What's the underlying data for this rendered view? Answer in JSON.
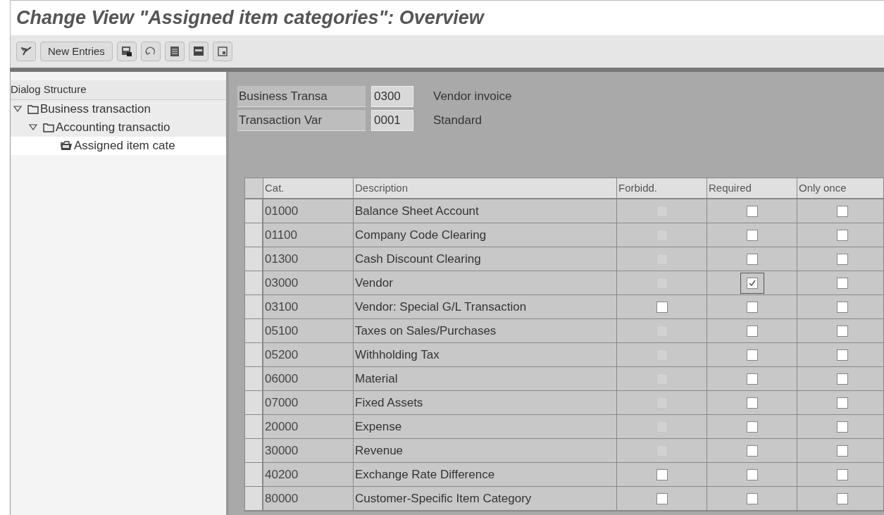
{
  "window": {
    "title": "Change View \"Assigned item categories\": Overview"
  },
  "toolbar": {
    "items": [
      {
        "kind": "icon"
      },
      {
        "kind": "text",
        "label": "New Entries"
      },
      {
        "kind": "icon"
      },
      {
        "kind": "icon"
      },
      {
        "kind": "icon"
      },
      {
        "kind": "icon"
      },
      {
        "kind": "icon"
      }
    ]
  },
  "dialog_structure": {
    "title": "Dialog Structure",
    "items": [
      {
        "label": "Business transaction",
        "expanded": true,
        "selected": false,
        "children": [
          {
            "label": "Accounting transactio",
            "expanded": true,
            "selected": false,
            "children": [
              {
                "label": "Assigned item cate",
                "selected": true
              }
            ]
          }
        ]
      }
    ]
  },
  "header_fields": [
    {
      "label": "Business Transa",
      "value": "0300",
      "description": "Vendor invoice"
    },
    {
      "label": "Transaction Var",
      "value": "0001",
      "description": "Standard"
    }
  ],
  "table": {
    "columns": [
      "Cat.",
      "Description",
      "Forbidd.",
      "Required",
      "Only once"
    ],
    "rows": [
      {
        "cat": "01000",
        "description": "Balance Sheet Account",
        "forbidden": {
          "checked": false,
          "disabled": true
        },
        "required": {
          "checked": false,
          "focused": false
        },
        "only_once": {
          "checked": false
        }
      },
      {
        "cat": "01100",
        "description": "Company Code Clearing",
        "forbidden": {
          "checked": false,
          "disabled": true
        },
        "required": {
          "checked": false,
          "focused": false
        },
        "only_once": {
          "checked": false
        }
      },
      {
        "cat": "01300",
        "description": "Cash Discount Clearing",
        "forbidden": {
          "checked": false,
          "disabled": true
        },
        "required": {
          "checked": false,
          "focused": false
        },
        "only_once": {
          "checked": false
        }
      },
      {
        "cat": "03000",
        "description": "Vendor",
        "forbidden": {
          "checked": false,
          "disabled": true
        },
        "required": {
          "checked": true,
          "focused": true
        },
        "only_once": {
          "checked": false
        }
      },
      {
        "cat": "03100",
        "description": "Vendor: Special G/L Transaction",
        "forbidden": {
          "checked": false,
          "disabled": false
        },
        "required": {
          "checked": false,
          "focused": false
        },
        "only_once": {
          "checked": false
        }
      },
      {
        "cat": "05100",
        "description": "Taxes on Sales/Purchases",
        "forbidden": {
          "checked": false,
          "disabled": true
        },
        "required": {
          "checked": false,
          "focused": false
        },
        "only_once": {
          "checked": false
        }
      },
      {
        "cat": "05200",
        "description": "Withholding Tax",
        "forbidden": {
          "checked": false,
          "disabled": true
        },
        "required": {
          "checked": false,
          "focused": false
        },
        "only_once": {
          "checked": false
        }
      },
      {
        "cat": "06000",
        "description": "Material",
        "forbidden": {
          "checked": false,
          "disabled": true
        },
        "required": {
          "checked": false,
          "focused": false
        },
        "only_once": {
          "checked": false
        }
      },
      {
        "cat": "07000",
        "description": "Fixed Assets",
        "forbidden": {
          "checked": false,
          "disabled": true
        },
        "required": {
          "checked": false,
          "focused": false
        },
        "only_once": {
          "checked": false
        }
      },
      {
        "cat": "20000",
        "description": "Expense",
        "forbidden": {
          "checked": false,
          "disabled": true
        },
        "required": {
          "checked": false,
          "focused": false
        },
        "only_once": {
          "checked": false
        }
      },
      {
        "cat": "30000",
        "description": "Revenue",
        "forbidden": {
          "checked": false,
          "disabled": true
        },
        "required": {
          "checked": false,
          "focused": false
        },
        "only_once": {
          "checked": false
        }
      },
      {
        "cat": "40200",
        "description": "Exchange Rate Difference",
        "forbidden": {
          "checked": false,
          "disabled": false
        },
        "required": {
          "checked": false,
          "focused": false
        },
        "only_once": {
          "checked": false
        }
      },
      {
        "cat": "80000",
        "description": "Customer-Specific Item Category",
        "forbidden": {
          "checked": false,
          "disabled": false
        },
        "required": {
          "checked": false,
          "focused": false
        },
        "only_once": {
          "checked": false
        }
      }
    ]
  }
}
